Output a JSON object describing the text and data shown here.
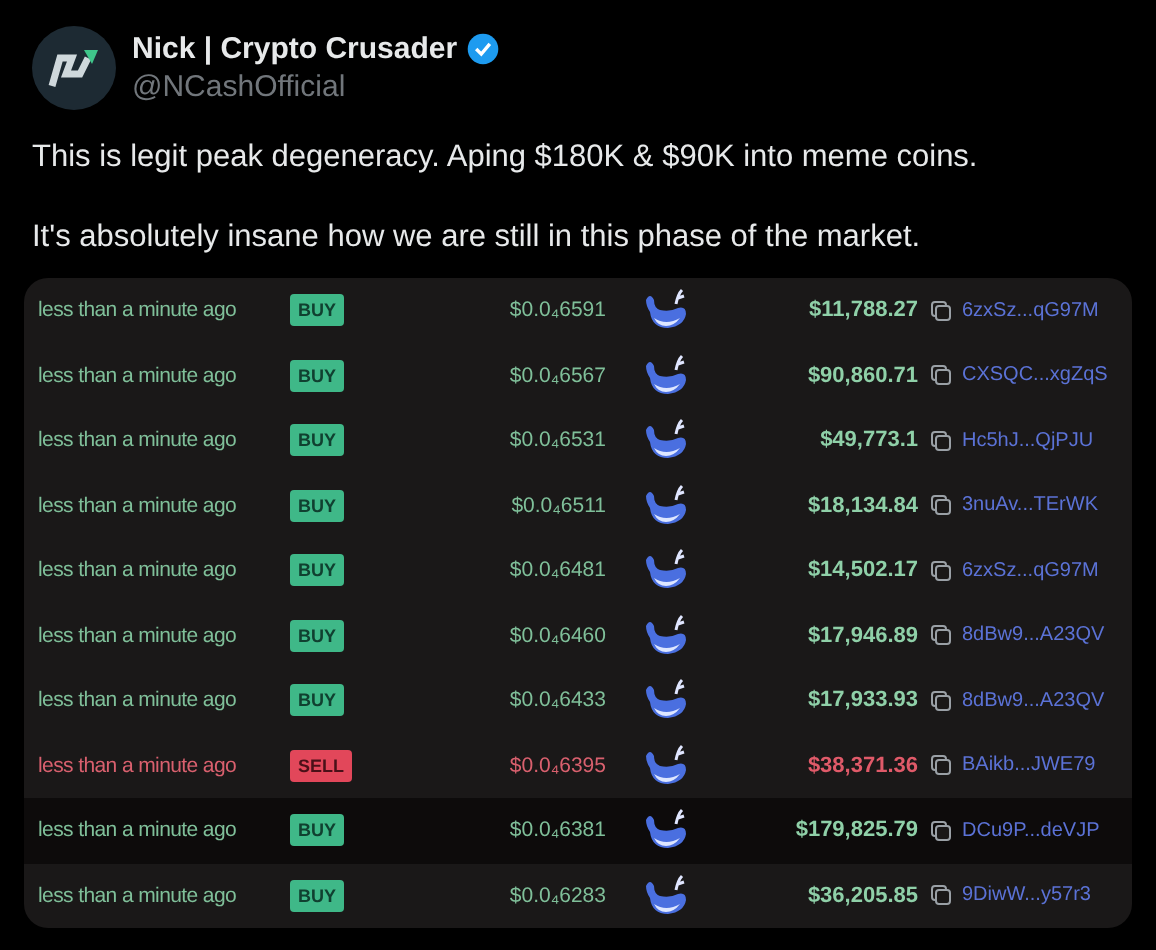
{
  "author": {
    "name": "Nick | Crypto Crusader",
    "verified": true,
    "handle": "@NCashOfficial"
  },
  "paragraphs": [
    "This is legit peak degeneracy. Aping $180K & $90K into meme coins.",
    "It's absolutely insane how we are still in this phase of the market."
  ],
  "trades": [
    {
      "time": "less than a minute ago",
      "kind": "buy",
      "side": "BUY",
      "price": "$0.0₄6591",
      "amount": "$11,788.27",
      "address": "6zxSz...qG97M",
      "highlighted": false
    },
    {
      "time": "less than a minute ago",
      "kind": "buy",
      "side": "BUY",
      "price": "$0.0₄6567",
      "amount": "$90,860.71",
      "address": "CXSQC...xgZqS",
      "highlighted": false
    },
    {
      "time": "less than a minute ago",
      "kind": "buy",
      "side": "BUY",
      "price": "$0.0₄6531",
      "amount": "$49,773.1",
      "address": "Hc5hJ...QjPJU",
      "highlighted": false
    },
    {
      "time": "less than a minute ago",
      "kind": "buy",
      "side": "BUY",
      "price": "$0.0₄6511",
      "amount": "$18,134.84",
      "address": "3nuAv...TErWK",
      "highlighted": false
    },
    {
      "time": "less than a minute ago",
      "kind": "buy",
      "side": "BUY",
      "price": "$0.0₄6481",
      "amount": "$14,502.17",
      "address": "6zxSz...qG97M",
      "highlighted": false
    },
    {
      "time": "less than a minute ago",
      "kind": "buy",
      "side": "BUY",
      "price": "$0.0₄6460",
      "amount": "$17,946.89",
      "address": "8dBw9...A23QV",
      "highlighted": false
    },
    {
      "time": "less than a minute ago",
      "kind": "buy",
      "side": "BUY",
      "price": "$0.0₄6433",
      "amount": "$17,933.93",
      "address": "8dBw9...A23QV",
      "highlighted": false
    },
    {
      "time": "less than a minute ago",
      "kind": "sell",
      "side": "SELL",
      "price": "$0.0₄6395",
      "amount": "$38,371.36",
      "address": "BAikb...JWE79",
      "highlighted": false
    },
    {
      "time": "less than a minute ago",
      "kind": "buy",
      "side": "BUY",
      "price": "$0.0₄6381",
      "amount": "$179,825.79",
      "address": "DCu9P...deVJP",
      "highlighted": true
    },
    {
      "time": "less than a minute ago",
      "kind": "buy",
      "side": "BUY",
      "price": "$0.0₄6283",
      "amount": "$36,205.85",
      "address": "9DiwW...y57r3",
      "highlighted": false
    }
  ]
}
